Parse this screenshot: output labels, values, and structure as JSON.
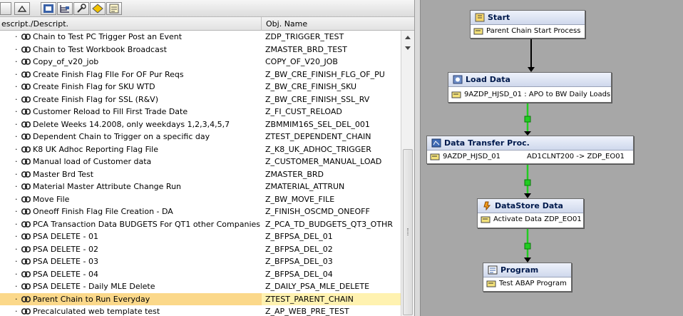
{
  "columns": {
    "description": "escript./Descript.",
    "obj_name": "Obj. Name"
  },
  "rows": [
    {
      "desc": "Chain to Test PC Trigger Post an Event",
      "obj": "ZDP_TRIGGER_TEST"
    },
    {
      "desc": "Chain to Test Workbook Broadcast",
      "obj": "ZMASTER_BRD_TEST"
    },
    {
      "desc": "Copy_of_v20_job",
      "obj": "COPY_OF_V20_JOB"
    },
    {
      "desc": "Create Finish Flag FIle For OF Pur Reqs",
      "obj": "Z_BW_CRE_FINISH_FLG_OF_PU"
    },
    {
      "desc": "Create Finish Flag for SKU WTD",
      "obj": "Z_BW_CRE_FINISH_SKU"
    },
    {
      "desc": "Create Finish Flag for SSL (R&V)",
      "obj": "Z_BW_CRE_FINISH_SSL_RV"
    },
    {
      "desc": "Customer Reload to Fill First Trade Date",
      "obj": "Z_FI_CUST_RELOAD"
    },
    {
      "desc": "Delete Weeks 14.2008, only weekdays 1,2,3,4,5,7",
      "obj": "ZBMMIM16S_SEL_DEL_001"
    },
    {
      "desc": "Dependent Chain to Trigger on a specific day",
      "obj": "ZTEST_DEPENDENT_CHAIN"
    },
    {
      "desc": "K8 UK Adhoc Reporting Flag File",
      "obj": "Z_K8_UK_ADHOC_TRIGGER"
    },
    {
      "desc": "Manual load of Customer data",
      "obj": "Z_CUSTOMER_MANUAL_LOAD"
    },
    {
      "desc": "Master Brd Test",
      "obj": "ZMASTER_BRD"
    },
    {
      "desc": "Material Master Attribute Change Run",
      "obj": "ZMATERIAL_ATTRUN"
    },
    {
      "desc": "Move File",
      "obj": "Z_BW_MOVE_FILE"
    },
    {
      "desc": "Oneoff Finish Flag File Creation - DA",
      "obj": "Z_FINISH_OSCMD_ONEOFF"
    },
    {
      "desc": "PCA Transaction Data BUDGETS For QT1 other Companies",
      "obj": "Z_PCA_TD_BUDGETS_QT3_OTHR"
    },
    {
      "desc": "PSA DELETE - 01",
      "obj": "Z_BFPSA_DEL_01"
    },
    {
      "desc": "PSA DELETE - 02",
      "obj": "Z_BFPSA_DEL_02"
    },
    {
      "desc": "PSA DELETE - 03",
      "obj": "Z_BFPSA_DEL_03"
    },
    {
      "desc": "PSA DELETE - 04",
      "obj": "Z_BFPSA_DEL_04"
    },
    {
      "desc": "PSA DELETE - Daily MLE Delete",
      "obj": "Z_DAILY_PSA_MLE_DELETE"
    },
    {
      "desc": "Parent Chain to Run Everyday",
      "obj": "ZTEST_PARENT_CHAIN"
    },
    {
      "desc": "Precalculated web template test",
      "obj": "Z_AP_WEB_PRE_TEST"
    }
  ],
  "selected_row": 21,
  "toolbar_icons": [
    "collapse-icon",
    "chain-view-icon",
    "tree-icon",
    "wrench-icon",
    "diamond-icon",
    "report-icon"
  ],
  "nodes": {
    "start": {
      "title": "Start",
      "body": "Parent Chain Start Process",
      "icon": "start-icon"
    },
    "load": {
      "title": "Load Data",
      "body": "9AZDP_HJSD_01 : APO to BW Daily Loads",
      "icon": "load-icon"
    },
    "dtp": {
      "title": "Data Transfer Proc.",
      "body_left": "9AZDP_HJSD_01",
      "body_right": "AD1CLNT200 -> ZDP_EO01",
      "icon": "dtp-icon"
    },
    "dso": {
      "title": "DataStore Data",
      "body": "Activate Data ZDP_EO01",
      "icon": "datastore-icon"
    },
    "program": {
      "title": "Program",
      "body": "Test ABAP Program",
      "icon": "program-icon"
    }
  },
  "colors": {
    "selected_row": "#fbd88a",
    "canvas": "#a7a7a7",
    "success_link": "#22cc22",
    "node_header": "#dbe2f1"
  }
}
